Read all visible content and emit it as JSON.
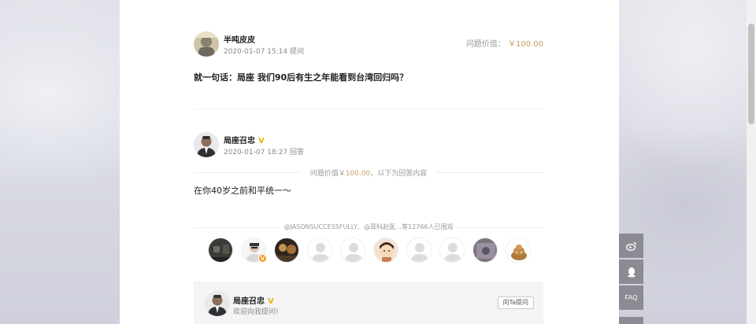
{
  "question": {
    "asker_name": "半吨皮皮",
    "date": "2020-01-07 15:14",
    "action": "提问",
    "value_label": "问题价值：",
    "value_amount": "￥100.00",
    "text": "就一句话：局座 我们90后有生之年能看到台湾回归吗？"
  },
  "answer": {
    "answerer_name": "局座召忠",
    "verified_mark": "V",
    "date": "2020-01-07 18:27",
    "action": "回答",
    "separator_prefix": "问题价值￥",
    "separator_amount": "100.00",
    "separator_suffix": "，以下为回答内容",
    "text": "在你40岁之前和平统一～"
  },
  "viewers": {
    "summary": "@JASONSUCCESSFULLY、@耳科赵医…等12766人已围观",
    "badge_text": "V",
    "avatars": [
      "viewer-1",
      "viewer-2",
      "viewer-3",
      "viewer-4",
      "viewer-5",
      "viewer-6",
      "viewer-7",
      "viewer-8",
      "viewer-9",
      "viewer-10"
    ]
  },
  "answerer_panel": {
    "name": "局座召忠",
    "verified_mark": "V",
    "welcome": "欢迎向我提问!",
    "ask_button": "向Ta提问"
  },
  "side_buttons": {
    "weibo_icon": "weibo-icon",
    "qq_icon": "qq-penguin-icon",
    "faq_label": "FAQ"
  },
  "colors": {
    "accent_gold": "#c9a063",
    "verified_yellow": "#e6b800",
    "side_button_bg": "#8b8c93"
  }
}
